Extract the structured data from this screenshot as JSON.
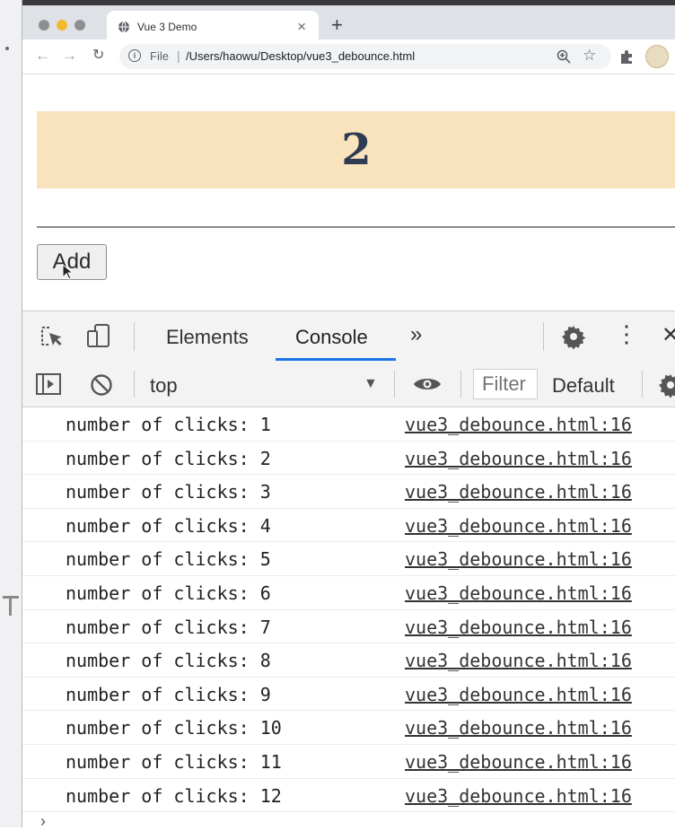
{
  "browser": {
    "tab_title": "Vue 3 Demo",
    "new_tab": "+",
    "tab_close": "×",
    "address": {
      "scheme": "File",
      "separator": "|",
      "url": "/Users/haowu/Desktop/vue3_debounce.html"
    }
  },
  "page": {
    "counter": "2",
    "add_button": "Add"
  },
  "devtools": {
    "tabs": {
      "elements": "Elements",
      "console": "Console",
      "more": "»"
    },
    "context": "top",
    "filter_placeholder": "Filter",
    "levels": "Default",
    "console": [
      {
        "message": "number of clicks: 1",
        "source": "vue3_debounce.html:16"
      },
      {
        "message": "number of clicks: 2",
        "source": "vue3_debounce.html:16"
      },
      {
        "message": "number of clicks: 3",
        "source": "vue3_debounce.html:16"
      },
      {
        "message": "number of clicks: 4",
        "source": "vue3_debounce.html:16"
      },
      {
        "message": "number of clicks: 5",
        "source": "vue3_debounce.html:16"
      },
      {
        "message": "number of clicks: 6",
        "source": "vue3_debounce.html:16"
      },
      {
        "message": "number of clicks: 7",
        "source": "vue3_debounce.html:16"
      },
      {
        "message": "number of clicks: 8",
        "source": "vue3_debounce.html:16"
      },
      {
        "message": "number of clicks: 9",
        "source": "vue3_debounce.html:16"
      },
      {
        "message": "number of clicks: 10",
        "source": "vue3_debounce.html:16"
      },
      {
        "message": "number of clicks: 11",
        "source": "vue3_debounce.html:16"
      },
      {
        "message": "number of clicks: 12",
        "source": "vue3_debounce.html:16"
      }
    ]
  },
  "colors": {
    "counter_bg": "#f8e3bc",
    "counter_text": "#2f3b52",
    "console_tab_underline": "#1a73e8"
  }
}
